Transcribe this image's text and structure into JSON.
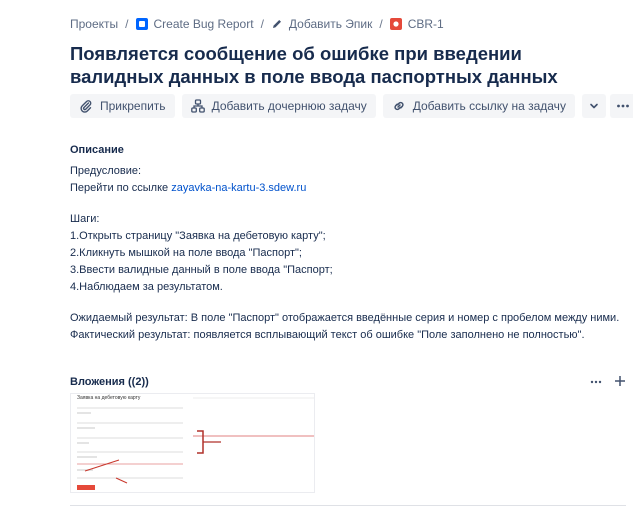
{
  "breadcrumb": {
    "projects": "Проекты",
    "project": "Create Bug Report",
    "epic": "Добавить Эпик",
    "issue": "CBR-1",
    "separator": "/"
  },
  "title": "Появляется сообщение об ошибке при введении валидных данных в поле ввода паспортных данных",
  "toolbar": {
    "attach": "Прикрепить",
    "child": "Добавить дочернюю задачу",
    "link": "Добавить ссылку на задачу"
  },
  "description": {
    "heading": "Описание",
    "precondition_label": "Предусловие:",
    "goto_prefix": "Перейти по ссылке ",
    "link": "zayavka-na-kartu-3.sdew.ru",
    "steps_label": "Шаги:",
    "steps": [
      "1.Открыть страницу \"Заявка на дебетовую карту\";",
      "2.Кликнуть мышкой на поле ввода \"Паспорт\";",
      "3.Ввести валидные данный в поле ввода \"Паспорт;",
      "4.Наблюдаем за результатом."
    ],
    "expected": "Ожидаемый результат: В поле \"Паспорт\" отображается введённые серия и номер с пробелом между ними.",
    "actual": "Фактический результат:  появляется всплывающий текст об ошибке \"Поле заполнено не полностью\"."
  },
  "attachments": {
    "title": "Вложения ((2))",
    "thumbnail_title": "Заявка на дебетовую карту"
  },
  "colors": {
    "accent": "#0052cc",
    "issue_icon": "#e5493a",
    "annotation": "#c9372c"
  }
}
